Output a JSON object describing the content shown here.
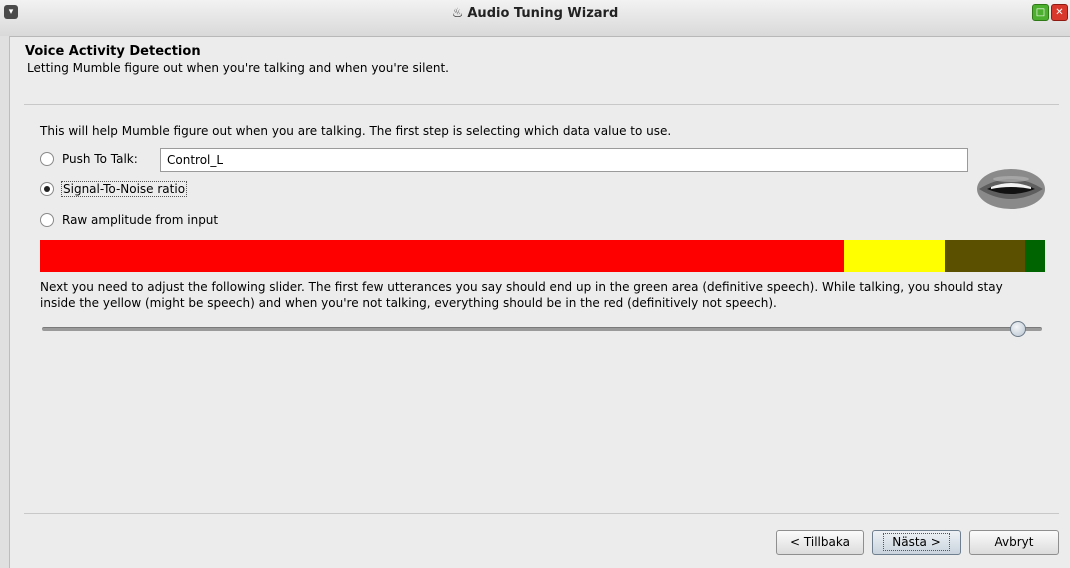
{
  "window": {
    "title": "Audio Tuning Wizard",
    "menu_glyph": "▾",
    "app_glyph": "♨",
    "maximize_glyph": "□",
    "close_glyph": "✕"
  },
  "header": {
    "title": "Voice Activity Detection",
    "subtitle": "Letting Mumble figure out when you're talking and when you're silent."
  },
  "intro": "This will help Mumble figure out when you are talking. The first step is selecting which data value to use.",
  "options": [
    {
      "label": "Push To Talk:",
      "checked": false
    },
    {
      "label": "Signal-To-Noise ratio",
      "checked": true
    },
    {
      "label": "Raw amplitude from input",
      "checked": false
    }
  ],
  "push_to_talk_key": "Control_L",
  "vad_bar": {
    "colors": {
      "red": "#ff0000",
      "yellow": "#ffff00",
      "olive": "#5a5000",
      "green": "#006400"
    },
    "segments_fraction": {
      "red": 0.8,
      "yellow": 0.1,
      "olive": 0.08,
      "green": 0.02
    }
  },
  "instruction": "Next you need to adjust the following slider. The first few utterances you say should end up in the green area (definitive speech). While talking, you should stay inside the yellow (might be speech) and when you're not talking, everything should be in the red (definitively not speech).",
  "slider_value_fraction": 0.975,
  "buttons": {
    "back": "< Tillbaka",
    "next": "Nästa >",
    "cancel": "Avbryt"
  }
}
